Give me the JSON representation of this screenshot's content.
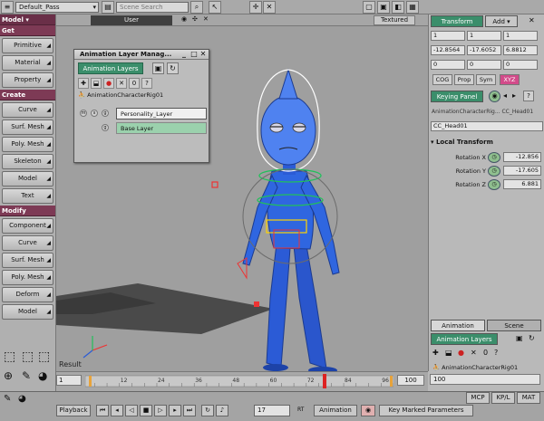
{
  "topbar": {
    "pass": "Default_Pass",
    "scene_search_placeholder": "Scene Search",
    "scene_search_value": "Scene Search"
  },
  "left_toolbar": {
    "module": "Model",
    "sections": [
      {
        "title": "Get",
        "items": [
          "Primitive",
          "Material",
          "Property"
        ]
      },
      {
        "title": "Create",
        "items": [
          "Curve",
          "Surf. Mesh",
          "Poly. Mesh",
          "Skeleton",
          "Model",
          "Text"
        ]
      },
      {
        "title": "Modify",
        "items": [
          "Component",
          "Curve",
          "Surf. Mesh",
          "Poly. Mesh",
          "Deform",
          "Model"
        ]
      }
    ]
  },
  "viewport": {
    "view": "User",
    "shading": "Textured",
    "result_label": "Result"
  },
  "anim_layer_manager": {
    "title": "Animation Layer Manag...",
    "tab": "Animation Layers",
    "rig": "AnimationCharacterRig01",
    "layers": [
      {
        "name": "Personality_Layer",
        "flags": [
          "m",
          "s",
          "g"
        ]
      },
      {
        "name": "Base Layer",
        "flags": [
          "g"
        ]
      }
    ]
  },
  "right_panel": {
    "tabs": [
      "Transform",
      "Add"
    ],
    "fields_row1": [
      "1",
      "1",
      "1"
    ],
    "fields_row2": [
      "-12.8564",
      "-17.6052",
      "6.8812"
    ],
    "fields_row3": [
      "0",
      "0",
      "0"
    ],
    "buttons": [
      "COG",
      "Prop",
      "Sym"
    ],
    "keying_panel": "Keying Panel",
    "path": "AnimationCharacterRig... CC_Head01",
    "object": "CC_Head01",
    "section": "Local Transform",
    "properties": [
      {
        "label": "Rotation X",
        "value": "-12.856"
      },
      {
        "label": "Rotation Y",
        "value": "-17.605"
      },
      {
        "label": "Rotation Z",
        "value": "6.881"
      }
    ]
  },
  "right_lower": {
    "tabs": [
      "Animation",
      "Scene"
    ],
    "layers_tab": "Animation Layers",
    "rig": "AnimationCharacterRig01"
  },
  "timeline": {
    "start": "1",
    "end": "100",
    "end2": "100",
    "ticks": [
      "12",
      "24",
      "36",
      "48",
      "60",
      "72",
      "84",
      "96"
    ],
    "current_marker": "72"
  },
  "bottom_bar": {
    "playback": "Playback",
    "frame": "17",
    "rt": "RT",
    "animation": "Animation",
    "key_marked": "Key Marked Parameters",
    "mcp": "MCP",
    "kpl": "KP/L",
    "mat": "MAT",
    "frame_end": "100"
  },
  "colors": {
    "section": "#7d3a55",
    "accent_green": "#3b8e6b",
    "character_blue": "#2b5bd6"
  }
}
